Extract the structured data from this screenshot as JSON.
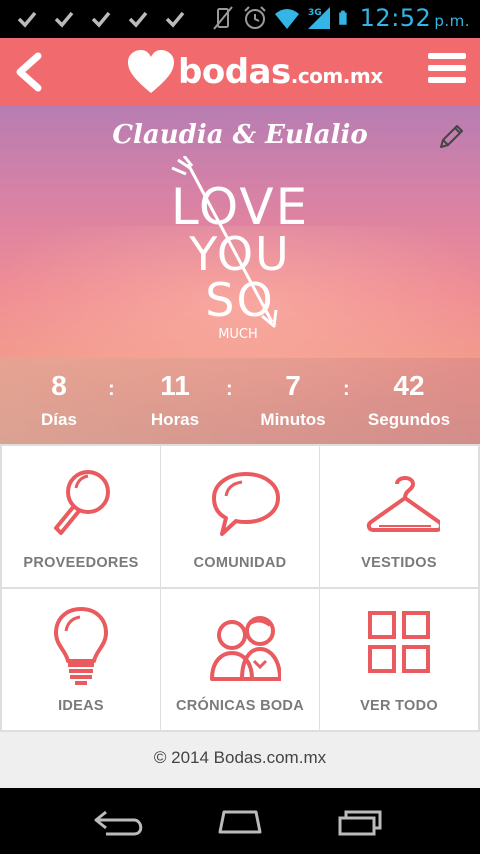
{
  "status_bar": {
    "notification_icons": [
      "check-icon",
      "check-icon",
      "check-icon",
      "check-icon",
      "check-icon"
    ],
    "time": "12:52",
    "ampm": "p.m.",
    "network": "3G"
  },
  "app_bar": {
    "logo_text": "bodas",
    "logo_suffix": ".com.mx"
  },
  "hero": {
    "couple_names": "Claudia & Eulalio",
    "art_line1": "LOVE",
    "art_line2": "YOU",
    "art_line3": "SO",
    "art_line4": "MUCH"
  },
  "countdown": [
    {
      "value": "8",
      "label": "Días"
    },
    {
      "value": "11",
      "label": "Horas"
    },
    {
      "value": "7",
      "label": "Minutos"
    },
    {
      "value": "42",
      "label": "Segundos"
    }
  ],
  "countdown_separator": ":",
  "tiles": [
    {
      "label": "PROVEEDORES",
      "icon": "magnifier-icon"
    },
    {
      "label": "COMUNIDAD",
      "icon": "speech-bubble-icon"
    },
    {
      "label": "VESTIDOS",
      "icon": "hanger-icon"
    },
    {
      "label": "IDEAS",
      "icon": "lightbulb-icon"
    },
    {
      "label": "CRÓNICAS BODA",
      "icon": "couple-icon"
    },
    {
      "label": "VER TODO",
      "icon": "grid-icon"
    }
  ],
  "footer": {
    "copyright": "© 2014 Bodas.com.mx"
  },
  "colors": {
    "brand": "#f06a6e",
    "icon": "#ea5b60",
    "status_accent": "#33b5e5"
  }
}
